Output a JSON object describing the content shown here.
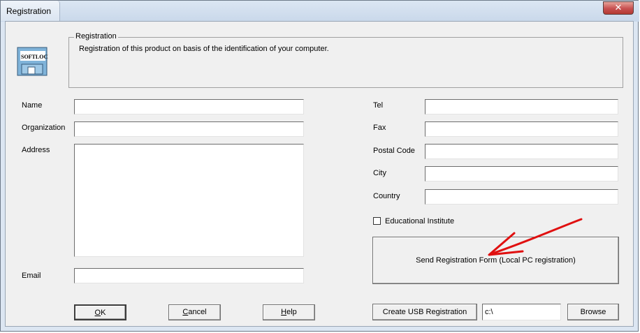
{
  "window": {
    "title": "Registration",
    "close_icon": "✕"
  },
  "logo": {
    "name": "SoftLock logo",
    "text": "SOFTLOCK"
  },
  "groupbox": {
    "title": "Registration",
    "description": "Registration of this product on basis of the identification of your computer."
  },
  "form": {
    "left": {
      "name_label": "Name",
      "organization_label": "Organization",
      "address_label": "Address",
      "email_label": "Email"
    },
    "right": {
      "tel_label": "Tel",
      "fax_label": "Fax",
      "postal_code_label": "Postal Code",
      "city_label": "City",
      "country_label": "Country"
    },
    "values": {
      "name": "",
      "organization": "",
      "address": "",
      "email": "",
      "tel": "",
      "fax": "",
      "postal_code": "",
      "city": "",
      "country": ""
    },
    "educational_label": "Educational Institute",
    "educational_checked": false
  },
  "buttons": {
    "send_registration": "Send Registration Form (Local PC registration)",
    "ok_rest": "K",
    "cancel_rest": "ancel",
    "help_rest": "elp",
    "create_usb": "Create USB Registration",
    "browse": "Browse"
  },
  "usb_path": {
    "value": "c:\\"
  },
  "colors": {
    "arrow": "#e01010",
    "window_border": "#6e7a89",
    "close_red": "#c75050"
  }
}
